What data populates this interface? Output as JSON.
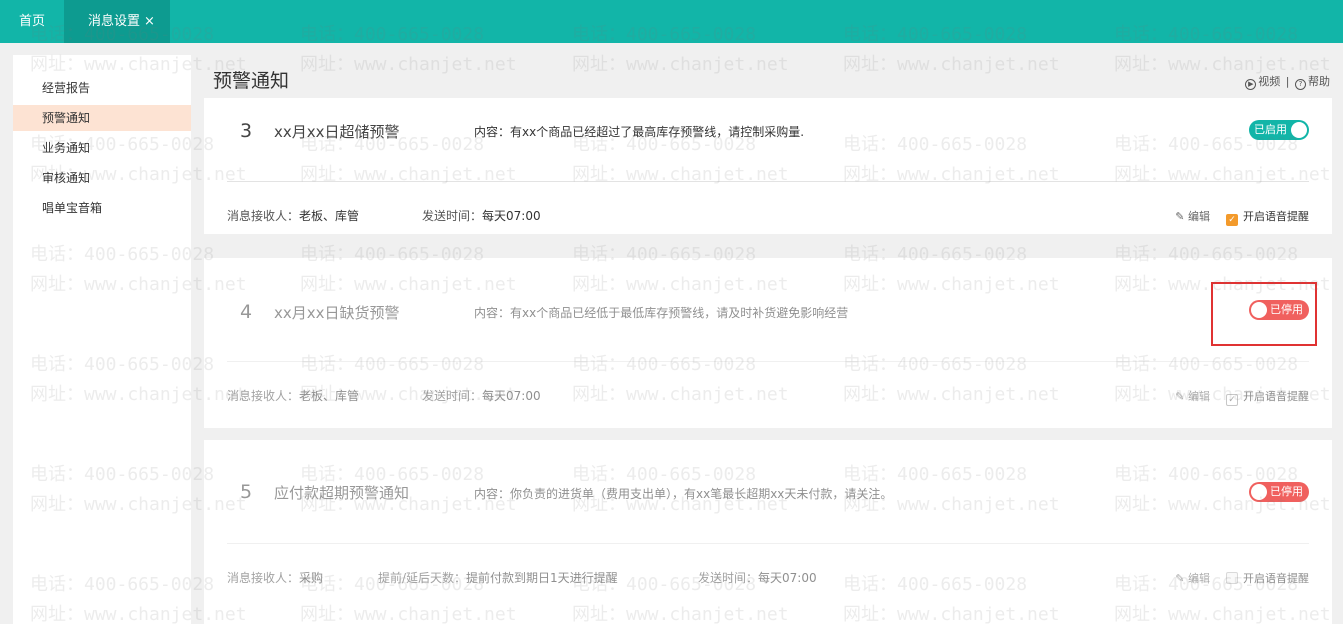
{
  "tabs": {
    "home": "首页",
    "active": "消息设置",
    "close": "×"
  },
  "sidebar": {
    "items": [
      {
        "label": "经营报告"
      },
      {
        "label": "预警通知"
      },
      {
        "label": "业务通知"
      },
      {
        "label": "审核通知"
      },
      {
        "label": "唱单宝音箱"
      }
    ],
    "active_index": 1
  },
  "page": {
    "title": "预警通知",
    "video_label": "视频",
    "separator": "|",
    "help_label": "帮助"
  },
  "cards": [
    {
      "num": "3",
      "title": "xx月xx日超储预警",
      "desc": "内容：有xx个商品已经超过了最高库存预警线，请控制采购量.",
      "status": "已启用",
      "enabled": true,
      "receivers_label": "消息接收人：",
      "receivers": "老板、库管",
      "time_label": "发送时间：",
      "time": "每天07:00",
      "edit": "编辑",
      "voice": "开启语音提醒",
      "voice_checked": true
    },
    {
      "num": "4",
      "title": "xx月xx日缺货预警",
      "desc": "内容：有xx个商品已经低于最低库存预警线，请及时补货避免影响经营",
      "status": "已停用",
      "enabled": false,
      "receivers_label": "消息接收人：",
      "receivers": "老板、库管",
      "time_label": "发送时间：",
      "time": "每天07:00",
      "edit": "编辑",
      "voice": "开启语音提醒",
      "voice_checked": true
    },
    {
      "num": "5",
      "title": "应付款超期预警通知",
      "desc": "内容：你负责的进货单（费用支出单），有xx笔最长超期xx天未付款，请关注。",
      "status": "已停用",
      "enabled": false,
      "receivers_label": "消息接收人：",
      "receivers": "采购",
      "days_label": "提前/延后天数：",
      "days": "提前付款到期日1天进行提醒",
      "time_label": "发送时间：",
      "time": "每天07:00",
      "edit": "编辑",
      "voice": "开启语音提醒",
      "voice_checked": false
    }
  ],
  "watermark": {
    "phone": "电话：400-665-0028",
    "site": "网址：www.chanjet.net"
  },
  "colors": {
    "teal": "#12b5a8",
    "teal_dark": "#0d9b90",
    "red": "#f0605e",
    "orange": "#f39a2b",
    "sidebar_active": "#fde3d3"
  }
}
